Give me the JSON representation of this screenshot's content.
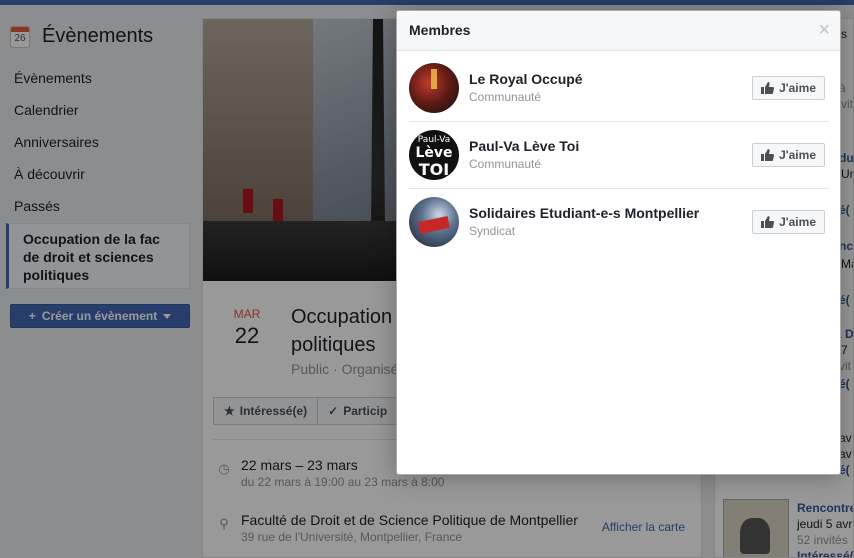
{
  "sidebar": {
    "title": "Évènements",
    "cal_num": "26",
    "items": [
      {
        "label": "Évènements"
      },
      {
        "label": "Calendrier"
      },
      {
        "label": "Anniversaires"
      },
      {
        "label": "À découvrir"
      },
      {
        "label": "Passés"
      }
    ],
    "active_event": "Occupation de la fac de droit et sciences politiques",
    "create_label": "Créer un évènement"
  },
  "event": {
    "month": "MAR",
    "day": "22",
    "title": "Occupation de la fac de droit et sciences politiques",
    "title_visible": "Occupation",
    "title_line2": "politiques",
    "subtitle": "Public · Organisé",
    "interested_label": "Intéressé(e)",
    "participate_label": "Particip",
    "date_main": "22 mars – 23 mars",
    "date_sub": "du 22 mars à 19:00 au 23 mars à 8:00",
    "place_main": "Faculté de Droit et de Science Politique de Montpellier",
    "place_sub": "39 rue de l'Université, Montpellier, France",
    "map_link": "Afficher la carte"
  },
  "right_col": {
    "s": "s",
    "lines": [
      "à",
      "vit",
      "du",
      "Ur",
      "é(",
      "nc",
      "Ma",
      "é(",
      "a D",
      "7",
      "vit",
      "é(",
      "av",
      "av",
      "é("
    ],
    "bottom_title": "Rencontre",
    "bottom_date": "jeudi 5 avr",
    "bottom_invites": "52 invités",
    "bottom_interested": "Intéressé("
  },
  "modal": {
    "title": "Membres",
    "close": "×",
    "like_label": "J'aime",
    "members": [
      {
        "name": "Le Royal Occupé",
        "category": "Communauté"
      },
      {
        "name": "Paul-Va Lève Toi",
        "category": "Communauté",
        "avatar_text": [
          "Paul-Va",
          "Lève",
          "TOI"
        ]
      },
      {
        "name": "Solidaires Etudiant-e-s Montpellier",
        "category": "Syndicat"
      }
    ]
  },
  "colors": {
    "brand": "#4267b2",
    "month_red": "#e9573e",
    "link": "#365899"
  }
}
